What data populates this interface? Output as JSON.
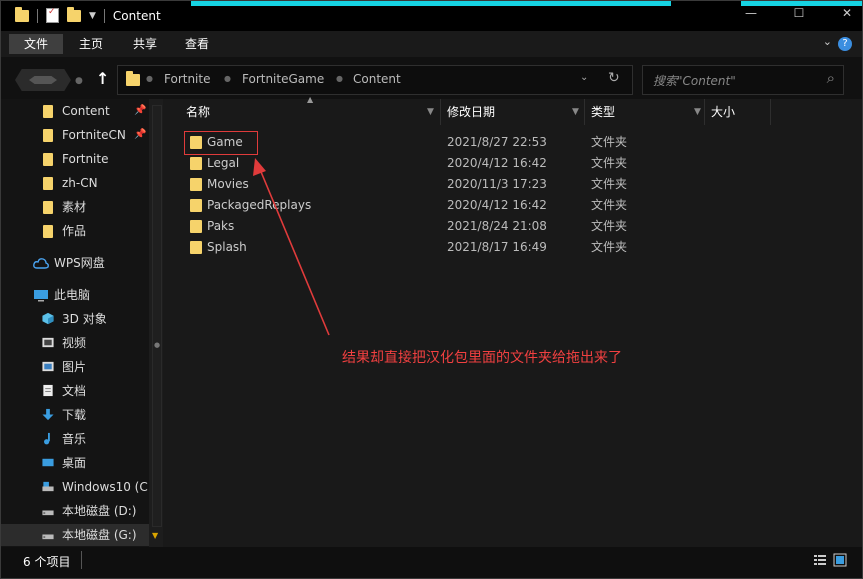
{
  "title": "Content",
  "ribbon": {
    "tabs": [
      "文件",
      "主页",
      "共享",
      "查看"
    ]
  },
  "address": {
    "crumbs": [
      "Fortnite",
      "FortniteGame",
      "Content"
    ]
  },
  "search": {
    "placeholder": "搜索\"Content\""
  },
  "sidebar": {
    "quick": [
      {
        "label": "Content",
        "pinned": true
      },
      {
        "label": "FortniteCN",
        "pinned": true
      },
      {
        "label": "Fortnite",
        "pinned": false
      },
      {
        "label": "zh-CN",
        "pinned": false
      },
      {
        "label": "素材",
        "pinned": false
      },
      {
        "label": "作品",
        "pinned": false
      }
    ],
    "wps": "WPS网盘",
    "pc": "此电脑",
    "pc_items": [
      "3D 对象",
      "视频",
      "图片",
      "文档",
      "下载",
      "音乐",
      "桌面",
      "Windows10 (C:",
      "本地磁盘 (D:)",
      "本地磁盘 (G:)"
    ]
  },
  "columns": {
    "name": "名称",
    "date": "修改日期",
    "type": "类型",
    "size": "大小"
  },
  "files": [
    {
      "name": "Game",
      "date": "2021/8/27 22:53",
      "type": "文件夹"
    },
    {
      "name": "Legal",
      "date": "2020/4/12 16:42",
      "type": "文件夹"
    },
    {
      "name": "Movies",
      "date": "2020/11/3 17:23",
      "type": "文件夹"
    },
    {
      "name": "PackagedReplays",
      "date": "2020/4/12 16:42",
      "type": "文件夹"
    },
    {
      "name": "Paks",
      "date": "2021/8/24 21:08",
      "type": "文件夹"
    },
    {
      "name": "Splash",
      "date": "2021/8/17 16:49",
      "type": "文件夹"
    }
  ],
  "annotation": "结果却直接把汉化包里面的文件夹给拖出来了",
  "status": "6 个项目",
  "colors": {
    "accent": "#16d3e3",
    "folder": "#f6d36b",
    "annotation": "#f04040"
  }
}
